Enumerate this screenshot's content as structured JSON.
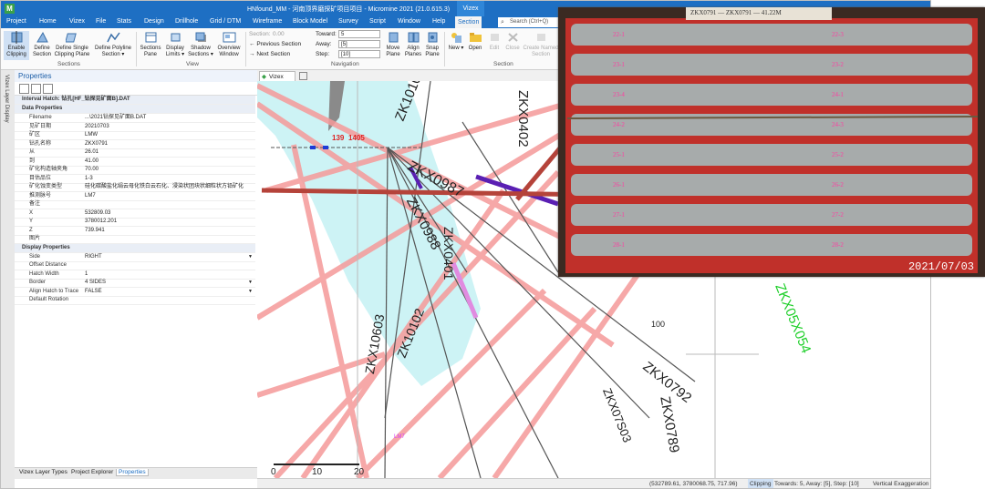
{
  "titlebar": {
    "app_icon": "M",
    "title": "HNfound_MM - 河南顶界磨探矿项目项目 - Micromine 2021 (21.0.615.3)",
    "context_tab": "Vizex"
  },
  "menubar": {
    "items": [
      "Project",
      "Home",
      "Vizex",
      "File",
      "Stats",
      "Design",
      "Drillhole",
      "Grid / DTM",
      "Wireframe",
      "Block Model",
      "Survey",
      "Script",
      "Window",
      "Help"
    ],
    "active": "Section",
    "search_placeholder": "Search (Ctrl+Q)"
  },
  "ribbon": {
    "clipping_buttons": [
      "Enable Clipping",
      "Define Section",
      "Define Single Clipping Plane",
      "Define Polyline Section ▾"
    ],
    "clipping_group": "Sections",
    "view_buttons": [
      "Sections Pane",
      "Display Limits ▾",
      "Shadow Sections ▾",
      "Overview Window"
    ],
    "view_group": "View",
    "nav_section_label": "Section:",
    "nav_section_value": "0.00",
    "nav_prev": "Previous Section",
    "nav_next": "Next Section",
    "toward_label": "Toward:",
    "toward_value": "5",
    "away_label": "Away:",
    "away_value": "[5]",
    "step_label": "Step:",
    "step_value": "[10]",
    "plane_buttons": [
      "Move Plane",
      "Align Planes",
      "Snap Plane"
    ],
    "navigation_group": "Navigation",
    "file_buttons": [
      "New ▾",
      "Open",
      "Edit",
      "Close",
      "Create Named Section"
    ],
    "file_group": "Section"
  },
  "sidestrip": {
    "label": "Vizex Layer Display"
  },
  "properties": {
    "header": "Properties",
    "object": "Interval Hatch: 钻孔[HF_钻探见矿面B].DAT",
    "data_section": "Data Properties",
    "data_rows": [
      {
        "k": "Filename",
        "v": "...\\2021钻探见矿面B.DAT"
      },
      {
        "k": "见矿日期",
        "v": "20210703"
      },
      {
        "k": "矿区",
        "v": "LMW"
      },
      {
        "k": "钻孔名称",
        "v": "ZKX0791"
      },
      {
        "k": "从",
        "v": "26.01"
      },
      {
        "k": "到",
        "v": "41.00"
      },
      {
        "k": "矿化构造轴夹角",
        "v": "70.00"
      },
      {
        "k": "目估品位",
        "v": "1-3"
      },
      {
        "k": "矿化蚀变类型",
        "v": "硅化碳酸盐化绢云母化铁白云石化、浸染状团块状细粒状方铅矿化"
      },
      {
        "k": "推测脉号",
        "v": "LM7"
      },
      {
        "k": "备注",
        "v": ""
      },
      {
        "k": "X",
        "v": "532809.03"
      },
      {
        "k": "Y",
        "v": "3780012.201"
      },
      {
        "k": "Z",
        "v": "739.941"
      },
      {
        "k": "图片",
        "v": ""
      }
    ],
    "display_section": "Display Properties",
    "display_rows": [
      {
        "k": "Side",
        "v": "RIGHT"
      },
      {
        "k": "Offset Distance",
        "v": ""
      },
      {
        "k": "Hatch Width",
        "v": "1"
      },
      {
        "k": "Border",
        "v": "4 SIDES"
      },
      {
        "k": "Align Hatch to Trace",
        "v": "FALSE"
      },
      {
        "k": "Default Rotation",
        "v": ""
      }
    ],
    "bottom_tabs": [
      "Vizex Layer Types",
      "Project Explorer",
      "Properties"
    ]
  },
  "viewport": {
    "tab_label": "Vizex",
    "hole_labels": [
      "ZK10101",
      "ZKX0402",
      "ZKX0987",
      "ZKX0988",
      "ZKX0401",
      "ZK10102",
      "ZKX10603",
      "ZKX0792",
      "ZKX07S03",
      "ZKX0789",
      "ZKX05X054"
    ],
    "markers": [
      "139",
      "1405"
    ],
    "scale": [
      "0",
      "10",
      "20"
    ],
    "tick_100": "100",
    "vein_label": "LM7"
  },
  "status": {
    "coords": "(532789.61, 3780068.75, 717.96)",
    "clipping": "Clipping",
    "clip_settings": "Towards: 5, Away: [5], Step: [10]",
    "vert_exag": "Vertical Exaggeration"
  },
  "photo": {
    "label_text": "ZKX0791 — ZKX0791 — 41.22M",
    "date_stamp": "2021/07/03",
    "core_tags": [
      "22-1",
      "22-3",
      "23-1",
      "23-2",
      "23-4",
      "24-1",
      "24-2",
      "24-3",
      "25-1",
      "25-2",
      "26-1",
      "26-2",
      "27-1",
      "27-2",
      "28-1",
      "28-2"
    ]
  },
  "colors": {
    "brand_blue": "#1e6fc3",
    "hatch_cyan": "#cdf3f5",
    "fault_pink": "#f59a9a",
    "arrow_red": "#b5433a",
    "tray_red": "#c0302a",
    "core_gray": "#a7abab",
    "green_label": "#1fcf2a",
    "magenta": "#d23cff",
    "purple_hatch": "#5a1fb3"
  }
}
